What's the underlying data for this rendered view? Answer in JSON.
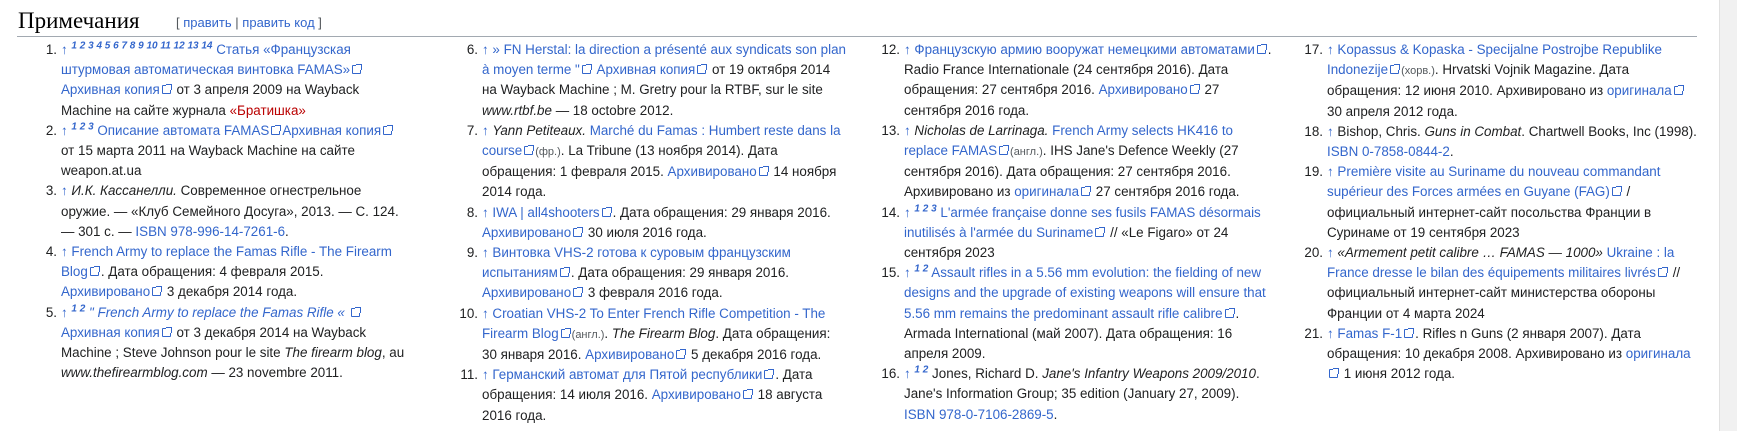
{
  "heading": {
    "title": "Примечания",
    "edit_open": "[",
    "edit_label": "править",
    "edit_sep": "|",
    "edit_code_label": "править код",
    "edit_close": "]"
  },
  "columns": [
    [
      {
        "n": "1.",
        "parts": [
          {
            "t": "up",
            "v": "↑ "
          },
          {
            "t": "sup",
            "v": "1 2 3 4 5 6 7 8 9 10 11 12 13 14"
          },
          {
            "t": "link",
            "v": " Статья «Французская штурмовая автоматическая винтовка FAMAS»"
          },
          {
            "t": "ext"
          },
          {
            "t": "link",
            "v": "Архивная копия"
          },
          {
            "t": "ext"
          },
          {
            "t": "text",
            "v": " от 3 апреля 2009 на "
          },
          {
            "t": "dark",
            "v": "Wayback Machine"
          },
          {
            "t": "text",
            "v": " на сайте журнала "
          },
          {
            "t": "red",
            "v": "«Братишка»"
          }
        ]
      },
      {
        "n": "2.",
        "parts": [
          {
            "t": "up",
            "v": "↑ "
          },
          {
            "t": "sup",
            "v": "1 2 3"
          },
          {
            "t": "link",
            "v": " Описание автомата FAMAS"
          },
          {
            "t": "ext"
          },
          {
            "t": "link",
            "v": "Архивная копия"
          },
          {
            "t": "ext"
          },
          {
            "t": "text",
            "v": " от 15 марта 2011 на "
          },
          {
            "t": "dark",
            "v": "Wayback Machine"
          },
          {
            "t": "text",
            "v": " на сайте weapon.at.ua"
          }
        ]
      },
      {
        "n": "3.",
        "parts": [
          {
            "t": "up",
            "v": "↑ "
          },
          {
            "t": "italic",
            "v": "И.К. Кассанелли."
          },
          {
            "t": "text",
            "v": " Современное огнестрельное оружие. — «Клуб Семейного Досуга», 2013. — С. 124. — 301 с. — "
          },
          {
            "t": "link",
            "v": "ISBN 978-996-14-7261-6"
          },
          {
            "t": "text",
            "v": "."
          }
        ]
      },
      {
        "n": "4.",
        "parts": [
          {
            "t": "up",
            "v": "↑ "
          },
          {
            "t": "link",
            "v": "French Army to replace the Famas Rifle - The Firearm Blog"
          },
          {
            "t": "ext"
          },
          {
            "t": "text",
            "v": ". Дата обращения: 4 февраля 2015. "
          },
          {
            "t": "link",
            "v": "Архивировано"
          },
          {
            "t": "ext"
          },
          {
            "t": "text",
            "v": " 3 декабря 2014 года."
          }
        ]
      },
      {
        "n": "5.",
        "parts": [
          {
            "t": "up",
            "v": "↑ "
          },
          {
            "t": "sup",
            "v": "1 2"
          },
          {
            "t": "linkitalic",
            "v": " \" French Army to replace the Famas Rifle « "
          },
          {
            "t": "ext"
          },
          {
            "t": "link",
            "v": " Архивная копия"
          },
          {
            "t": "ext"
          },
          {
            "t": "text",
            "v": " от 3 декабря 2014 на "
          },
          {
            "t": "dark",
            "v": "Wayback Machine"
          },
          {
            "t": "text",
            "v": " ; Steve Johnson pour le site "
          },
          {
            "t": "italic",
            "v": "The firearm blog"
          },
          {
            "t": "text",
            "v": ", au "
          },
          {
            "t": "italic",
            "v": "www.thefirearmblog.com"
          },
          {
            "t": "text",
            "v": " — 23 novembre 2011."
          }
        ]
      }
    ],
    [
      {
        "n": "6.",
        "parts": [
          {
            "t": "up",
            "v": "↑ "
          },
          {
            "t": "link",
            "v": "» FN Herstal: la direction a présenté aux syndicats son plan à moyen terme \""
          },
          {
            "t": "ext"
          },
          {
            "t": "link",
            "v": " Архивная копия"
          },
          {
            "t": "ext"
          },
          {
            "t": "text",
            "v": " от 19 октября 2014 на "
          },
          {
            "t": "dark",
            "v": "Wayback Machine"
          },
          {
            "t": "text",
            "v": " ; M. Gretry pour la RTBF, sur le site "
          },
          {
            "t": "italic",
            "v": "www.rtbf.be"
          },
          {
            "t": "text",
            "v": " — 18 octobre 2012."
          }
        ]
      },
      {
        "n": "7.",
        "parts": [
          {
            "t": "up",
            "v": "↑ "
          },
          {
            "t": "italic",
            "v": "Yann Petiteaux."
          },
          {
            "t": "link",
            "v": " Marché du Famas : Humbert reste dans la course"
          },
          {
            "t": "ext"
          },
          {
            "t": "lang",
            "v": "(фр.)"
          },
          {
            "t": "text",
            "v": ". La Tribune (13 ноября 2014). Дата обращения: 1 февраля 2015. "
          },
          {
            "t": "link",
            "v": "Архивировано"
          },
          {
            "t": "ext"
          },
          {
            "t": "text",
            "v": " 14 ноября 2014 года."
          }
        ]
      },
      {
        "n": "8.",
        "parts": [
          {
            "t": "up",
            "v": "↑ "
          },
          {
            "t": "link",
            "v": "IWA | all4shooters"
          },
          {
            "t": "ext"
          },
          {
            "t": "text",
            "v": ". Дата обращения: 29 января 2016. "
          },
          {
            "t": "link",
            "v": "Архивировано"
          },
          {
            "t": "ext"
          },
          {
            "t": "text",
            "v": " 30 июля 2016 года."
          }
        ]
      },
      {
        "n": "9.",
        "parts": [
          {
            "t": "up",
            "v": "↑ "
          },
          {
            "t": "link",
            "v": "Винтовка VHS-2 готова к суровым французским испытаниям"
          },
          {
            "t": "ext"
          },
          {
            "t": "text",
            "v": ". Дата обращения: 29 января 2016. "
          },
          {
            "t": "link",
            "v": "Архивировано"
          },
          {
            "t": "ext"
          },
          {
            "t": "text",
            "v": " 3 февраля 2016 года."
          }
        ]
      },
      {
        "n": "10.",
        "parts": [
          {
            "t": "up",
            "v": "↑ "
          },
          {
            "t": "link",
            "v": "Croatian VHS-2 To Enter French Rifle Competition - The Firearm Blog"
          },
          {
            "t": "ext"
          },
          {
            "t": "lang",
            "v": "(англ.)"
          },
          {
            "t": "text",
            "v": ". "
          },
          {
            "t": "italic",
            "v": "The Firearm Blog"
          },
          {
            "t": "text",
            "v": ". Дата обращения: 30 января 2016. "
          },
          {
            "t": "link",
            "v": "Архивировано"
          },
          {
            "t": "ext"
          },
          {
            "t": "text",
            "v": " 5 декабря 2016 года."
          }
        ]
      },
      {
        "n": "11.",
        "parts": [
          {
            "t": "up",
            "v": "↑ "
          },
          {
            "t": "link",
            "v": "Германский автомат для Пятой республики"
          },
          {
            "t": "ext"
          },
          {
            "t": "text",
            "v": ". Дата обращения: 14 июля 2016. "
          },
          {
            "t": "link",
            "v": "Архивировано"
          },
          {
            "t": "ext"
          },
          {
            "t": "text",
            "v": " 18 августа 2016 года."
          }
        ]
      }
    ],
    [
      {
        "n": "12.",
        "parts": [
          {
            "t": "up",
            "v": "↑ "
          },
          {
            "t": "link",
            "v": "Французскую армию вооружат немецкими автоматами"
          },
          {
            "t": "ext"
          },
          {
            "t": "text",
            "v": ". Radio France Internationale (24 сентября 2016). Дата обращения: 27 сентября 2016. "
          },
          {
            "t": "link",
            "v": "Архивировано"
          },
          {
            "t": "ext"
          },
          {
            "t": "text",
            "v": " 27 сентября 2016 года."
          }
        ]
      },
      {
        "n": "13.",
        "parts": [
          {
            "t": "up",
            "v": "↑ "
          },
          {
            "t": "italic",
            "v": "Nicholas de Larrinaga."
          },
          {
            "t": "link",
            "v": " French Army selects HK416 to replace FAMAS"
          },
          {
            "t": "ext"
          },
          {
            "t": "lang",
            "v": "(англ.)"
          },
          {
            "t": "text",
            "v": ". IHS Jane's Defence Weekly (27 сентября 2016). Дата обращения: 27 сентября 2016. Архивировано из "
          },
          {
            "t": "link",
            "v": "оригинала"
          },
          {
            "t": "ext"
          },
          {
            "t": "text",
            "v": " 27 сентября 2016 года."
          }
        ]
      },
      {
        "n": "14.",
        "parts": [
          {
            "t": "up",
            "v": "↑ "
          },
          {
            "t": "sup",
            "v": "1 2 3"
          },
          {
            "t": "link",
            "v": " L'armée française donne ses fusils FAMAS désormais inutilisés à l'armée du Suriname"
          },
          {
            "t": "ext"
          },
          {
            "t": "text",
            "v": " // «Le Figaro» от 24 сентября 2023"
          }
        ]
      },
      {
        "n": "15.",
        "parts": [
          {
            "t": "up",
            "v": "↑ "
          },
          {
            "t": "sup",
            "v": "1 2"
          },
          {
            "t": "link",
            "v": " Assault rifles in a 5.56 mm evolution: the fielding of new designs and the upgrade of existing weapons will ensure that 5.56 mm remains the predominant assault rifle calibre"
          },
          {
            "t": "ext"
          },
          {
            "t": "text",
            "v": ". Armada International (май 2007). Дата обращения: 16 апреля 2009."
          }
        ]
      },
      {
        "n": "16.",
        "parts": [
          {
            "t": "up",
            "v": "↑ "
          },
          {
            "t": "sup",
            "v": "1 2"
          },
          {
            "t": "text",
            "v": " Jones, Richard D. "
          },
          {
            "t": "italic",
            "v": "Jane's Infantry Weapons 2009/2010"
          },
          {
            "t": "text",
            "v": ". Jane's Information Group; 35 edition (January 27, 2009). "
          },
          {
            "t": "link",
            "v": "ISBN 978-0-7106-2869-5"
          },
          {
            "t": "text",
            "v": "."
          }
        ]
      }
    ],
    [
      {
        "n": "17.",
        "parts": [
          {
            "t": "up",
            "v": "↑ "
          },
          {
            "t": "link",
            "v": "Kopassus & Kopaska - Specijalne Postrojbe Republike Indonezije"
          },
          {
            "t": "ext"
          },
          {
            "t": "lang",
            "v": "(хорв.)"
          },
          {
            "t": "text",
            "v": ". Hrvatski Vojnik Magazine. Дата обращения: 12 июня 2010. Архивировано из "
          },
          {
            "t": "link",
            "v": "оригинала"
          },
          {
            "t": "ext"
          },
          {
            "t": "text",
            "v": " 30 апреля 2012 года."
          }
        ]
      },
      {
        "n": "18.",
        "parts": [
          {
            "t": "up",
            "v": "↑ "
          },
          {
            "t": "text",
            "v": "Bishop, Chris. "
          },
          {
            "t": "italic",
            "v": "Guns in Combat"
          },
          {
            "t": "text",
            "v": ". Chartwell Books, Inc (1998). "
          },
          {
            "t": "link",
            "v": "ISBN 0-7858-0844-2"
          },
          {
            "t": "text",
            "v": "."
          }
        ]
      },
      {
        "n": "19.",
        "parts": [
          {
            "t": "up",
            "v": "↑ "
          },
          {
            "t": "link",
            "v": "Première visite au Suriname du nouveau commandant supérieur des Forces armées en Guyane (FAG)"
          },
          {
            "t": "ext"
          },
          {
            "t": "text",
            "v": " / официальный интернет-сайт посольства Франции в Суринаме от 19 сентября 2023"
          }
        ]
      },
      {
        "n": "20.",
        "parts": [
          {
            "t": "up",
            "v": "↑ "
          },
          {
            "t": "italic",
            "v": "«Armement petit calibre … FAMAS — 1000»"
          },
          {
            "t": "link",
            "v": " Ukraine : la France dresse le bilan des équipements militaires livrés"
          },
          {
            "t": "ext"
          },
          {
            "t": "text",
            "v": " // официальный интернет-сайт министерства обороны Франции от 4 марта 2024"
          }
        ]
      },
      {
        "n": "21.",
        "parts": [
          {
            "t": "up",
            "v": "↑ "
          },
          {
            "t": "link",
            "v": "Famas F-1"
          },
          {
            "t": "ext"
          },
          {
            "t": "text",
            "v": ". Rifles n Guns (2 января 2007). Дата обращения: 10 декабря 2008. Архивировано из "
          },
          {
            "t": "link",
            "v": "оригинала"
          },
          {
            "t": "ext"
          },
          {
            "t": "text",
            "v": " 1 июня 2012 года."
          }
        ]
      }
    ]
  ]
}
